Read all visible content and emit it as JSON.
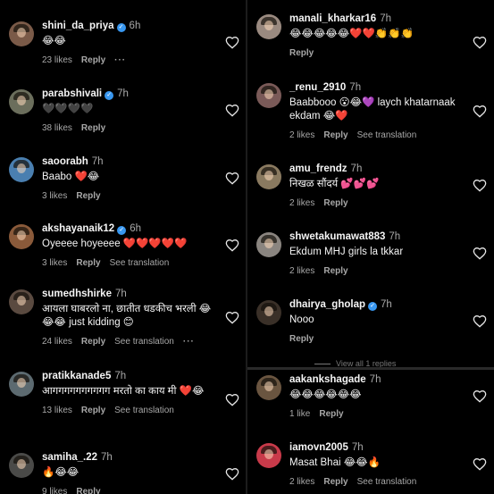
{
  "left": [
    {
      "user": "shini_da_priya",
      "verified": true,
      "time": "6h",
      "text": "😂😂",
      "likes": "23 likes",
      "reply": "Reply",
      "more": "···",
      "translate": "",
      "avatar": "#7a5a48"
    },
    {
      "user": "parabshivali",
      "verified": true,
      "time": "7h",
      "text": "🖤🖤🖤🖤",
      "likes": "38 likes",
      "reply": "Reply",
      "more": "",
      "translate": "",
      "avatar": "#6b6e5c"
    },
    {
      "user": "saoorabh",
      "verified": false,
      "time": "7h",
      "text": "Baabo ❤️😂",
      "likes": "3 likes",
      "reply": "Reply",
      "more": "",
      "translate": "",
      "avatar": "#4a7fb0"
    },
    {
      "user": "akshayanaik12",
      "verified": true,
      "time": "6h",
      "text": "Oyeeee hoyeeee ❤️❤️❤️❤️❤️",
      "likes": "3 likes",
      "reply": "Reply",
      "more": "",
      "translate": "See translation",
      "avatar": "#8a5a3a"
    },
    {
      "user": "sumedhshirke",
      "verified": false,
      "time": "7h",
      "text": "आयला घाबरलो ना, छातीत धडकीच भरली 😂😂😂 just kidding 😊",
      "likes": "24 likes",
      "reply": "Reply",
      "more": "···",
      "translate": "See translation",
      "avatar": "#5a4a40"
    },
    {
      "user": "pratikkanade5",
      "verified": false,
      "time": "7h",
      "text": "आगगगगगगगगगग मरतो का काय मी ❤️😂",
      "likes": "13 likes",
      "reply": "Reply",
      "more": "",
      "translate": "See translation",
      "avatar": "#5c6a70"
    },
    {
      "user": "samiha_.22",
      "verified": false,
      "time": "7h",
      "text": "🔥😂😂",
      "likes": "9 likes",
      "reply": "Reply",
      "more": "",
      "translate": "",
      "avatar": "#4a4a48"
    }
  ],
  "right": [
    {
      "user": "manali_kharkar16",
      "verified": false,
      "time": "7h",
      "text": "😂😂😂😂😂❤️❤️👏👏👏",
      "likes": "",
      "reply": "Reply",
      "more": "",
      "translate": "",
      "avatar": "#9a8a80"
    },
    {
      "user": "_renu_2910",
      "verified": false,
      "time": "7h",
      "text": "Baabbooo 😮😂💜 laych khatarnaak ekdam 😂❤️",
      "likes": "2 likes",
      "reply": "Reply",
      "more": "",
      "translate": "See translation",
      "avatar": "#7a5a58"
    },
    {
      "user": "amu_frendz",
      "verified": false,
      "time": "7h",
      "text": "निखळ सौंदर्य 💕💕💕",
      "likes": "2 likes",
      "reply": "Reply",
      "more": "",
      "translate": "",
      "avatar": "#8a7a60"
    },
    {
      "user": "shwetakumawat883",
      "verified": false,
      "time": "7h",
      "text": "Ekdum MHJ girls la tkkar",
      "likes": "2 likes",
      "reply": "Reply",
      "more": "",
      "translate": "",
      "avatar": "#8a8580"
    },
    {
      "user": "dhairya_gholap",
      "verified": true,
      "time": "7h",
      "text": "Nooo",
      "likes": "",
      "reply": "Reply",
      "more": "",
      "translate": "",
      "avatar": "#3a3028"
    },
    {
      "user": "aakankshagade",
      "verified": false,
      "time": "7h",
      "text": "😂😂😂😂😂😂",
      "likes": "1 like",
      "reply": "Reply",
      "more": "",
      "translate": "",
      "avatar": "#6a5540"
    },
    {
      "user": "iamovn2005",
      "verified": false,
      "time": "7h",
      "text": "Masat Bhai 😂😂🔥",
      "likes": "2 likes",
      "reply": "Reply",
      "more": "",
      "translate": "See translation",
      "avatar": "#c83a4a"
    }
  ],
  "view_replies": "View all 1 replies"
}
